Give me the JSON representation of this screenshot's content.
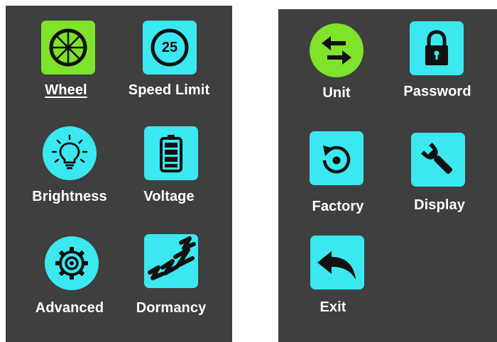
{
  "colors": {
    "panel": "#3f3f3f",
    "tile_cyan": "#3be8f0",
    "tile_green": "#7fe22b",
    "icon": "#111111",
    "text": "#ffffff"
  },
  "left_menu": {
    "items": [
      {
        "label": "Wheel",
        "icon": "wheel-icon",
        "selected": true
      },
      {
        "label": "Speed Limit",
        "icon": "speed-limit-icon"
      },
      {
        "label": "Brightness",
        "icon": "lightbulb-icon"
      },
      {
        "label": "Voltage",
        "icon": "battery-icon"
      },
      {
        "label": "Advanced",
        "icon": "gear-icon"
      },
      {
        "label": "Dormancy",
        "icon": "sleep-zzz-icon"
      }
    ],
    "speed_limit_value": "25"
  },
  "right_menu": {
    "items": [
      {
        "label": "Unit",
        "icon": "swap-arrows-icon",
        "selected": true
      },
      {
        "label": "Password",
        "icon": "padlock-icon"
      },
      {
        "label": "Factory",
        "icon": "reset-icon"
      },
      {
        "label": "Display",
        "icon": "wrench-icon"
      },
      {
        "label": "Exit",
        "icon": "back-arrow-icon"
      }
    ]
  }
}
